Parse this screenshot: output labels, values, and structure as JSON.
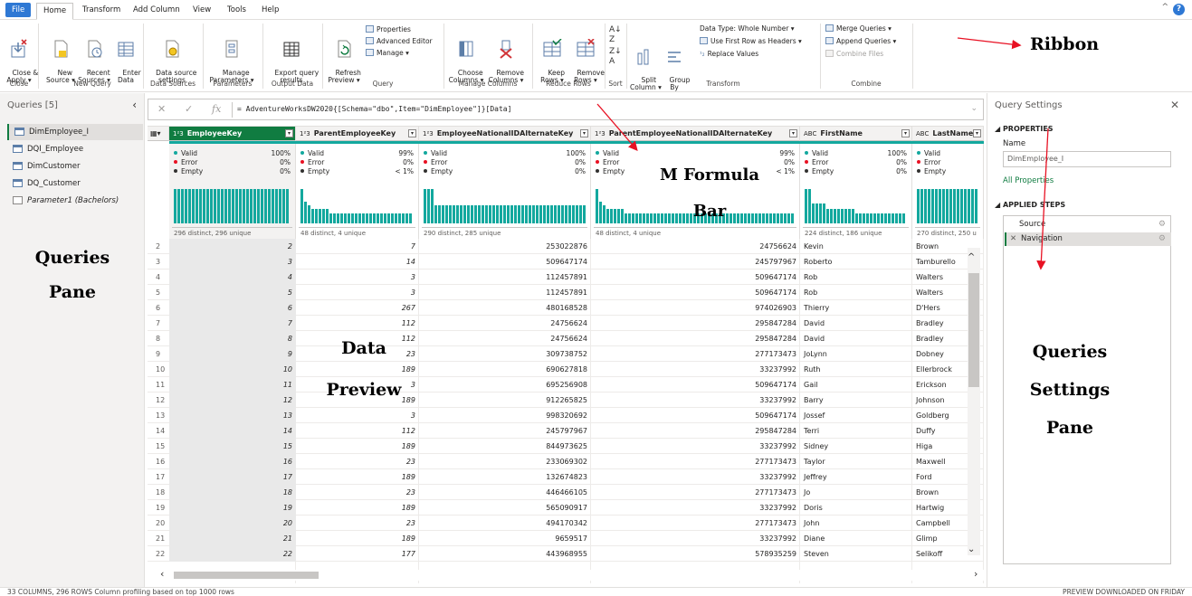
{
  "menu": {
    "tabs": [
      "File",
      "Home",
      "Transform",
      "Add Column",
      "View",
      "Tools",
      "Help"
    ]
  },
  "ribbon": {
    "close_apply": "Close &\nApply ▾",
    "new_source": "New\nSource ▾",
    "recent_sources": "Recent\nSources ▾",
    "enter_data": "Enter\nData",
    "data_source_settings": "Data source\nsettings",
    "manage_parameters": "Manage\nParameters ▾",
    "export_query_results": "Export query\nresults",
    "refresh_preview": "Refresh\nPreview ▾",
    "properties": "Properties",
    "advanced_editor": "Advanced Editor",
    "manage": "Manage ▾",
    "choose_columns": "Choose\nColumns ▾",
    "remove_columns": "Remove\nColumns ▾",
    "keep_rows": "Keep\nRows ▾",
    "remove_rows": "Remove\nRows ▾",
    "split_column": "Split\nColumn ▾",
    "group_by": "Group\nBy",
    "data_type": "Data Type: Whole Number ▾",
    "first_row_headers": "Use First Row as Headers ▾",
    "replace_values": "Replace Values",
    "merge_queries": "Merge Queries ▾",
    "append_queries": "Append Queries ▾",
    "combine_files": "Combine Files",
    "groups": {
      "close": "Close",
      "new_query": "New Query",
      "data_sources": "Data Sources",
      "parameters": "Parameters",
      "output_data": "Output Data",
      "query": "Query",
      "manage_columns": "Manage Columns",
      "reduce_rows": "Reduce Rows",
      "sort": "Sort",
      "transform": "Transform",
      "combine": "Combine"
    }
  },
  "annotations": {
    "ribbon": "Ribbon",
    "formula_bar": "M Formula\nBar",
    "queries_pane": "Queries\nPane",
    "data_preview": "Data\nPreview",
    "settings_pane": "Queries\nSettings\nPane"
  },
  "queries_pane": {
    "header": "Queries [5]",
    "items": [
      {
        "name": "DimEmployee_I",
        "selected": true,
        "kind": "table"
      },
      {
        "name": "DQI_Employee",
        "selected": false,
        "kind": "table"
      },
      {
        "name": "DimCustomer",
        "selected": false,
        "kind": "table"
      },
      {
        "name": "DQ_Customer",
        "selected": false,
        "kind": "table"
      },
      {
        "name": "Parameter1 (Bachelors)",
        "selected": false,
        "kind": "parameter"
      }
    ]
  },
  "formula": {
    "text": "= AdventureWorksDW2020{[Schema=\"dbo\",Item=\"DimEmployee\"]}[Data]"
  },
  "columns": [
    {
      "type": "1²3",
      "name": "EmployeeKey",
      "valid": "100%",
      "error": "0%",
      "empty": "0%",
      "summary": "296 distinct, 296 unique",
      "active": true
    },
    {
      "type": "1²3",
      "name": "ParentEmployeeKey",
      "valid": "99%",
      "error": "0%",
      "empty": "< 1%",
      "summary": "48 distinct, 4 unique",
      "active": false
    },
    {
      "type": "1²3",
      "name": "EmployeeNationalIDAlternateKey",
      "valid": "100%",
      "error": "0%",
      "empty": "0%",
      "summary": "290 distinct, 285 unique",
      "active": false
    },
    {
      "type": "1²3",
      "name": "ParentEmployeeNationalIDAlternateKey",
      "valid": "99%",
      "error": "0%",
      "empty": "< 1%",
      "summary": "48 distinct, 4 unique",
      "active": false
    },
    {
      "type": "ABC",
      "name": "FirstName",
      "valid": "100%",
      "error": "0%",
      "empty": "0%",
      "summary": "224 distinct, 186 unique",
      "active": false
    },
    {
      "type": "ABC",
      "name": "LastName",
      "valid": "",
      "error": "",
      "empty": "",
      "summary": "270 distinct, 250 u",
      "active": false
    }
  ],
  "profile_labels": {
    "valid": "Valid",
    "error": "Error",
    "empty": "Empty"
  },
  "rows": [
    [
      2,
      2,
      7,
      253022876,
      24756624,
      "Kevin",
      "Brown"
    ],
    [
      3,
      3,
      14,
      509647174,
      245797967,
      "Roberto",
      "Tamburello"
    ],
    [
      4,
      4,
      3,
      112457891,
      509647174,
      "Rob",
      "Walters"
    ],
    [
      5,
      5,
      3,
      112457891,
      509647174,
      "Rob",
      "Walters"
    ],
    [
      6,
      6,
      267,
      480168528,
      974026903,
      "Thierry",
      "D'Hers"
    ],
    [
      7,
      7,
      112,
      24756624,
      295847284,
      "David",
      "Bradley"
    ],
    [
      8,
      8,
      112,
      24756624,
      295847284,
      "David",
      "Bradley"
    ],
    [
      9,
      9,
      23,
      309738752,
      277173473,
      "JoLynn",
      "Dobney"
    ],
    [
      10,
      10,
      189,
      690627818,
      33237992,
      "Ruth",
      "Ellerbrock"
    ],
    [
      11,
      11,
      3,
      695256908,
      509647174,
      "Gail",
      "Erickson"
    ],
    [
      12,
      12,
      189,
      912265825,
      33237992,
      "Barry",
      "Johnson"
    ],
    [
      13,
      13,
      3,
      998320692,
      509647174,
      "Jossef",
      "Goldberg"
    ],
    [
      14,
      14,
      112,
      245797967,
      295847284,
      "Terri",
      "Duffy"
    ],
    [
      15,
      15,
      189,
      844973625,
      33237992,
      "Sidney",
      "Higa"
    ],
    [
      16,
      16,
      23,
      233069302,
      277173473,
      "Taylor",
      "Maxwell"
    ],
    [
      17,
      17,
      189,
      132674823,
      33237992,
      "Jeffrey",
      "Ford"
    ],
    [
      18,
      18,
      23,
      446466105,
      277173473,
      "Jo",
      "Brown"
    ],
    [
      19,
      19,
      189,
      565090917,
      33237992,
      "Doris",
      "Hartwig"
    ],
    [
      20,
      20,
      23,
      494170342,
      277173473,
      "John",
      "Campbell"
    ],
    [
      21,
      21,
      189,
      9659517,
      33237992,
      "Diane",
      "Glimp"
    ],
    [
      22,
      22,
      177,
      443968955,
      578935259,
      "Steven",
      "Selikoff"
    ]
  ],
  "settings_pane": {
    "title": "Query Settings",
    "properties": "PROPERTIES",
    "name_label": "Name",
    "name_value": "DimEmployee_I",
    "all_properties": "All Properties",
    "applied_steps": "APPLIED STEPS",
    "steps": [
      {
        "name": "Source",
        "selected": false
      },
      {
        "name": "Navigation",
        "selected": true
      }
    ]
  },
  "status": {
    "left": "33 COLUMNS, 296 ROWS    Column profiling based on top 1000 rows",
    "right": "PREVIEW DOWNLOADED ON FRIDAY"
  },
  "colors": {
    "accent_green": "#107c41",
    "profile_teal": "#13a89e",
    "file_blue": "#2e78d4",
    "arrow_red": "#e81123"
  }
}
